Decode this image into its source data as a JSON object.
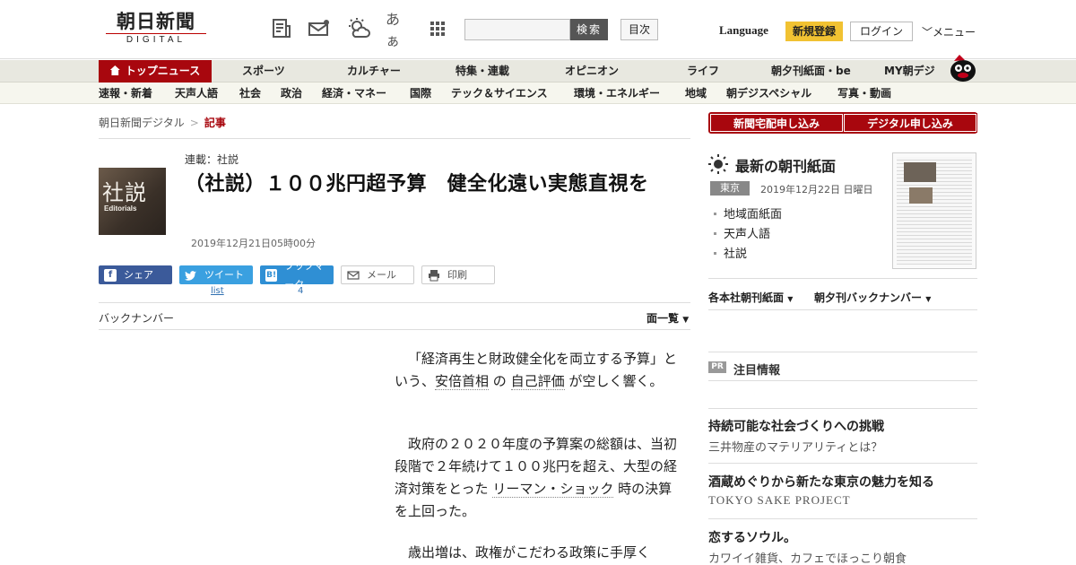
{
  "header": {
    "logo_jp": "朝日新聞",
    "logo_en": "DIGITAL",
    "icons": [
      "newspaper-icon",
      "mail-icon",
      "weather-icon",
      "font-size-icon",
      "apps-grid-icon"
    ],
    "font_icon_text": "あぁ",
    "search_placeholder": "",
    "search_button": "検索",
    "contents_button": "目次",
    "language": "Language",
    "register": "新規登録",
    "login": "ログイン",
    "menu": "メニュー"
  },
  "nav_main": [
    "トップニュース",
    "スポーツ",
    "カルチャー",
    "特集・連載",
    "オピニオン",
    "ライフ",
    "朝夕刊紙面・be",
    "MY朝デジ"
  ],
  "nav_sub": [
    "速報・新着",
    "天声人語",
    "社会",
    "政治",
    "経済・マネー",
    "国際",
    "テック＆サイエンス",
    "環境・エネルギー",
    "地域",
    "朝デジスペシャル",
    "写真・動画"
  ],
  "breadcrumb": {
    "home": "朝日新聞デジタル",
    "sep": ">",
    "current": "記事"
  },
  "article": {
    "thumb_kanji": "社説",
    "thumb_en": "Editorials",
    "series": "連載：社説",
    "title": "（社説）１００兆円超予算　健全化遠い実態直視を",
    "date": "2019年12月21日05時00分"
  },
  "share": {
    "facebook": "シェア",
    "twitter": "ツイート",
    "twitter_sub": "list",
    "hatena": "ブックマーク",
    "hatena_icon": "B!",
    "hatena_count": "4",
    "mail": "メール",
    "print": "印刷"
  },
  "backnumber": "バックナンバー",
  "menlist": "面一覧",
  "body": {
    "p1_a": "「経済再生と財政健全化を両立する予算」という、",
    "p1_link1": "安倍首相",
    "p1_b": " の ",
    "p1_link2": "自己評価",
    "p1_c": " が空しく響く。",
    "p2_a": "政府の２０２０年度の予算案の総額は、当初段階で２年続けて１００兆円を超え、大型の経済対策をとった ",
    "p2_link": "リーマン・ショック",
    "p2_b": " 時の決算を上回った。",
    "p3": "歳出増は、政権がこだわる政策に手厚く"
  },
  "right": {
    "btn1": "新聞宅配申し込み",
    "btn2": "デジタル申し込み",
    "kanmen_title": "最新の朝刊紙面",
    "edition": "東京",
    "kanmen_date": "2019年12月22日 日曜日",
    "links": [
      "地域面紙面",
      "天声人語",
      "社説"
    ],
    "dropdown1": "各本社朝刊紙面",
    "dropdown2": "朝夕刊バックナンバー",
    "pr": "PR",
    "chumoku": "注目情報",
    "ads": [
      {
        "title": "持続可能な社会づくりへの挑戦",
        "sub": "三井物産のマテリアリティとは？"
      },
      {
        "title": "酒蔵めぐりから新たな東京の魅力を知る",
        "sub": "TOKYO SAKE PROJECT"
      },
      {
        "title": "恋するソウル。",
        "sub": "カワイイ雑貨、カフェでほっこり朝食"
      }
    ]
  },
  "colors": {
    "brand_red": "#a8070e",
    "register_yellow": "#f1c232",
    "facebook": "#3b5a9a",
    "twitter": "#3aa0e0"
  }
}
